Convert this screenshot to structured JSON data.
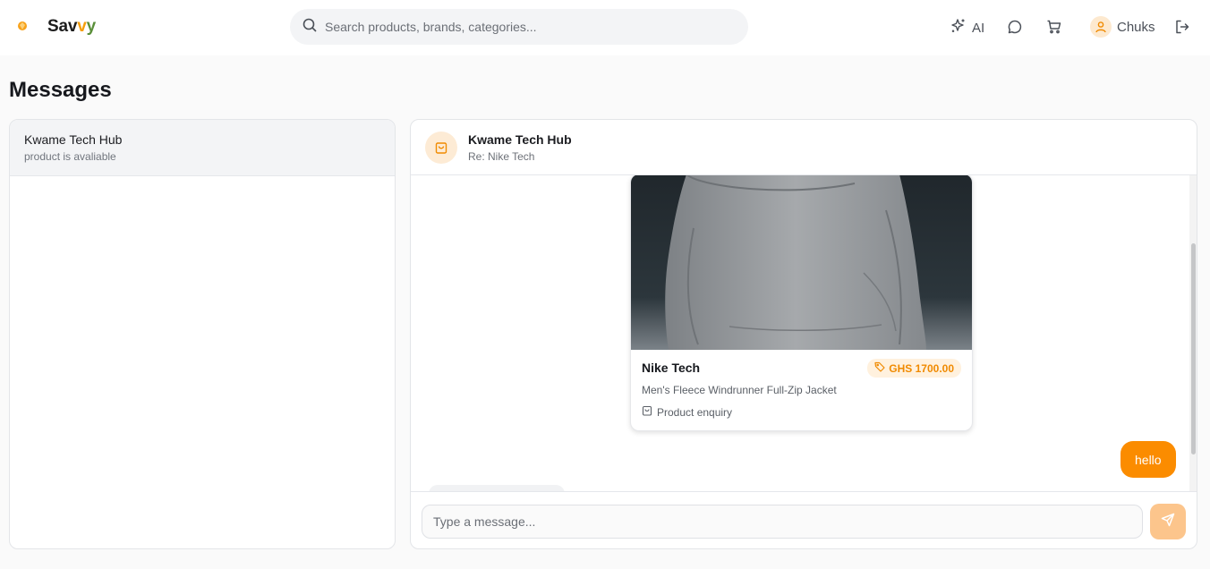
{
  "app": {
    "brand": {
      "prefix": "Sav",
      "v1": "v",
      "v2": "y"
    }
  },
  "search": {
    "placeholder": "Search products, brands, categories..."
  },
  "nav": {
    "ai_label": "AI",
    "user_name": "Chuks"
  },
  "page": {
    "title": "Messages"
  },
  "conversations": [
    {
      "name": "Kwame Tech Hub",
      "preview": "product is avaliable"
    }
  ],
  "chat": {
    "title": "Kwame Tech Hub",
    "subtitle": "Re: Nike Tech",
    "product": {
      "name": "Nike Tech",
      "price": "GHS 1700.00",
      "description": "Men's Fleece Windrunner Full-Zip Jacket",
      "tag": "Product enquiry"
    },
    "messages": [
      {
        "from": "me",
        "text": "hello"
      }
    ],
    "composer_placeholder": "Type a message..."
  },
  "colors": {
    "accent": "#fb8c00",
    "accent_light": "#fff1de",
    "send_disabled": "#fcc58c"
  },
  "icons": [
    "search-icon",
    "sparkles-icon",
    "chat-icon",
    "cart-icon",
    "user-icon",
    "logout-icon",
    "shopping-bag-icon",
    "tag-icon",
    "send-icon"
  ]
}
